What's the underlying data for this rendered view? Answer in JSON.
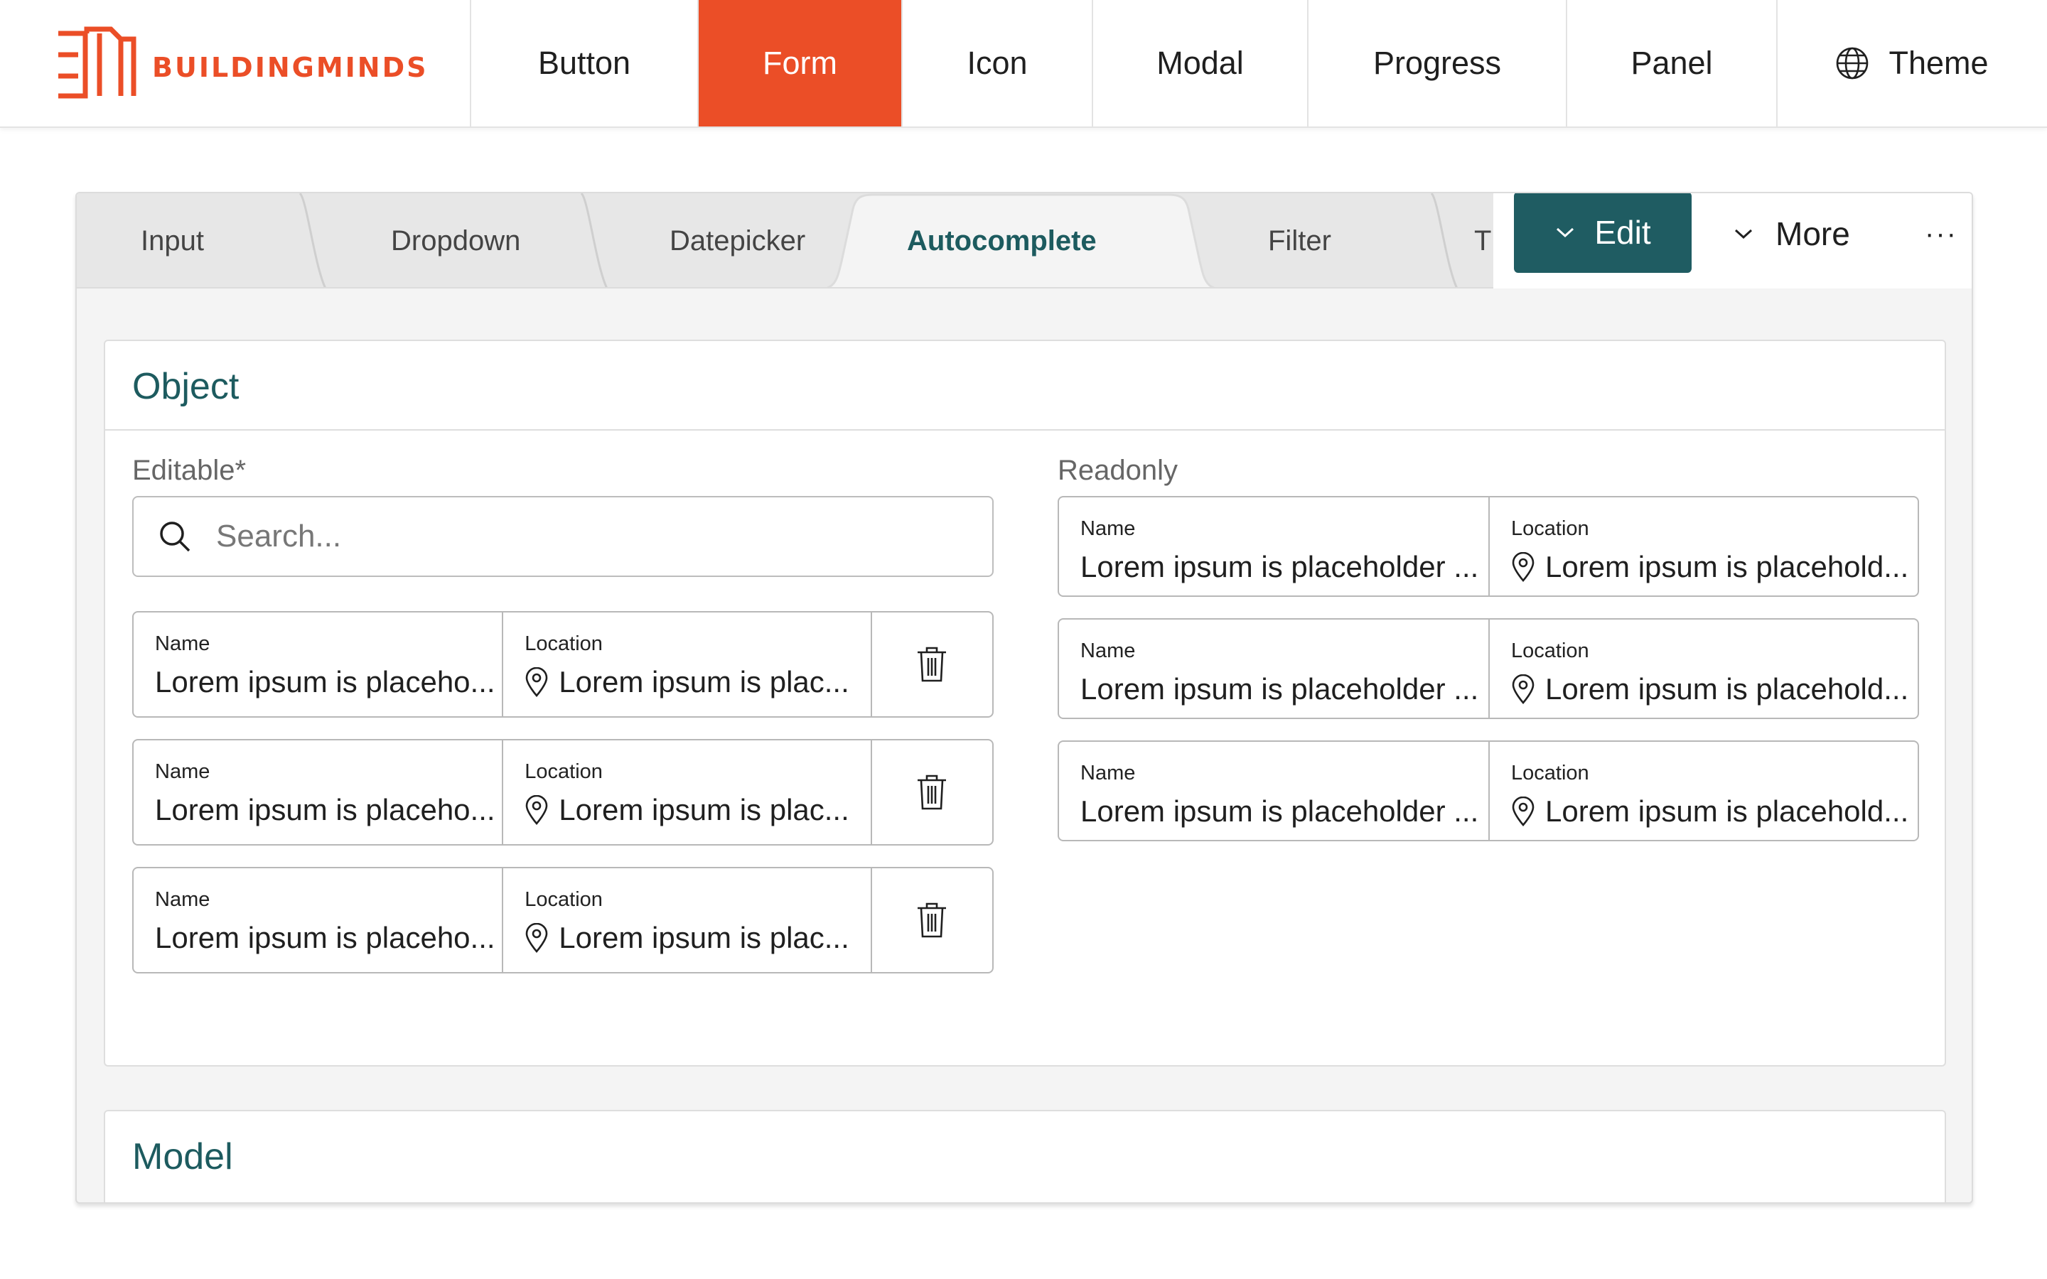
{
  "brand": {
    "name": "BUILDINGMINDS",
    "color": "#eb4e27"
  },
  "nav": {
    "items": [
      {
        "label": "Button"
      },
      {
        "label": "Form"
      },
      {
        "label": "Icon"
      },
      {
        "label": "Modal"
      },
      {
        "label": "Progress"
      },
      {
        "label": "Panel"
      }
    ],
    "active": "Form",
    "theme_label": "Theme"
  },
  "tabs": {
    "items": [
      "Input",
      "Dropdown",
      "Datepicker",
      "Autocomplete",
      "Filter",
      "T"
    ],
    "active": "Autocomplete"
  },
  "toolbar": {
    "edit_label": "Edit",
    "more_label": "More",
    "overflow_label": "···"
  },
  "object_section": {
    "title": "Object",
    "editable": {
      "label": "Editable*",
      "search_placeholder": "Search...",
      "rows": [
        {
          "name_label": "Name",
          "name_value": "Lorem ipsum is placeho...",
          "location_label": "Location",
          "location_value": "Lorem ipsum is plac..."
        },
        {
          "name_label": "Name",
          "name_value": "Lorem ipsum is placeho...",
          "location_label": "Location",
          "location_value": "Lorem ipsum is plac..."
        },
        {
          "name_label": "Name",
          "name_value": "Lorem ipsum is placeho...",
          "location_label": "Location",
          "location_value": "Lorem ipsum is plac..."
        }
      ]
    },
    "readonly": {
      "label": "Readonly",
      "rows": [
        {
          "name_label": "Name",
          "name_value": "Lorem ipsum is placeholder ...",
          "location_label": "Location",
          "location_value": "Lorem ipsum is placehold..."
        },
        {
          "name_label": "Name",
          "name_value": "Lorem ipsum is placeholder ...",
          "location_label": "Location",
          "location_value": "Lorem ipsum is placehold..."
        },
        {
          "name_label": "Name",
          "name_value": "Lorem ipsum is placeholder ...",
          "location_label": "Location",
          "location_value": "Lorem ipsum is placehold..."
        }
      ]
    }
  },
  "model_section": {
    "title": "Model"
  },
  "colors": {
    "accent": "#eb4e27",
    "primary": "#1f5c62",
    "heading": "#1d5b5f"
  },
  "icons": [
    "buildingminds-logo-icon",
    "globe-icon",
    "chevron-down-icon",
    "search-icon",
    "location-pin-icon",
    "trash-icon"
  ]
}
